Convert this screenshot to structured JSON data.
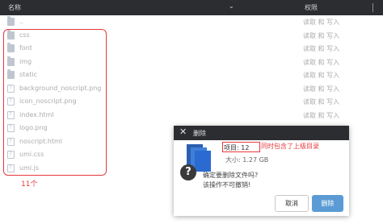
{
  "header": {
    "name_label": "名称",
    "sort_icon": "chevron-down-icon",
    "permission_label": "权限"
  },
  "files": [
    {
      "name": "..",
      "type": "folder",
      "permission": "读取 和 写入"
    },
    {
      "name": "css",
      "type": "folder",
      "permission": "读取 和 写入"
    },
    {
      "name": "font",
      "type": "folder",
      "permission": "读取 和 写入"
    },
    {
      "name": "img",
      "type": "folder",
      "permission": "读取 和 写入"
    },
    {
      "name": "static",
      "type": "folder",
      "permission": "读取 和 写入"
    },
    {
      "name": "background_noscript.png",
      "type": "file",
      "permission": "读取 和 写入"
    },
    {
      "name": "icon_noscript.png",
      "type": "file",
      "permission": "读取 和 写入"
    },
    {
      "name": "index.html",
      "type": "file",
      "permission": "读取 和 写入"
    },
    {
      "name": "logo.png",
      "type": "file",
      "permission": ""
    },
    {
      "name": "noscript.html",
      "type": "file",
      "permission": ""
    },
    {
      "name": "umi.css",
      "type": "file",
      "permission": ""
    },
    {
      "name": "umi.js",
      "type": "file",
      "permission": ""
    }
  ],
  "annotations": {
    "count_label": "11个",
    "parent_note": "同时包含了上级目录"
  },
  "dialog": {
    "title": "删除",
    "items_label": "项目: 12",
    "size_label": "大小: 1.27 GB",
    "confirm_line1": "确定要删除文件吗?",
    "confirm_line2": "该操作不可撤销!",
    "cancel_label": "取消",
    "delete_label": "删除"
  },
  "colors": {
    "header_bg": "#2b2d30",
    "annotation": "#e5393d",
    "primary": "#5b9bd5",
    "icon": "#8b97aa"
  }
}
